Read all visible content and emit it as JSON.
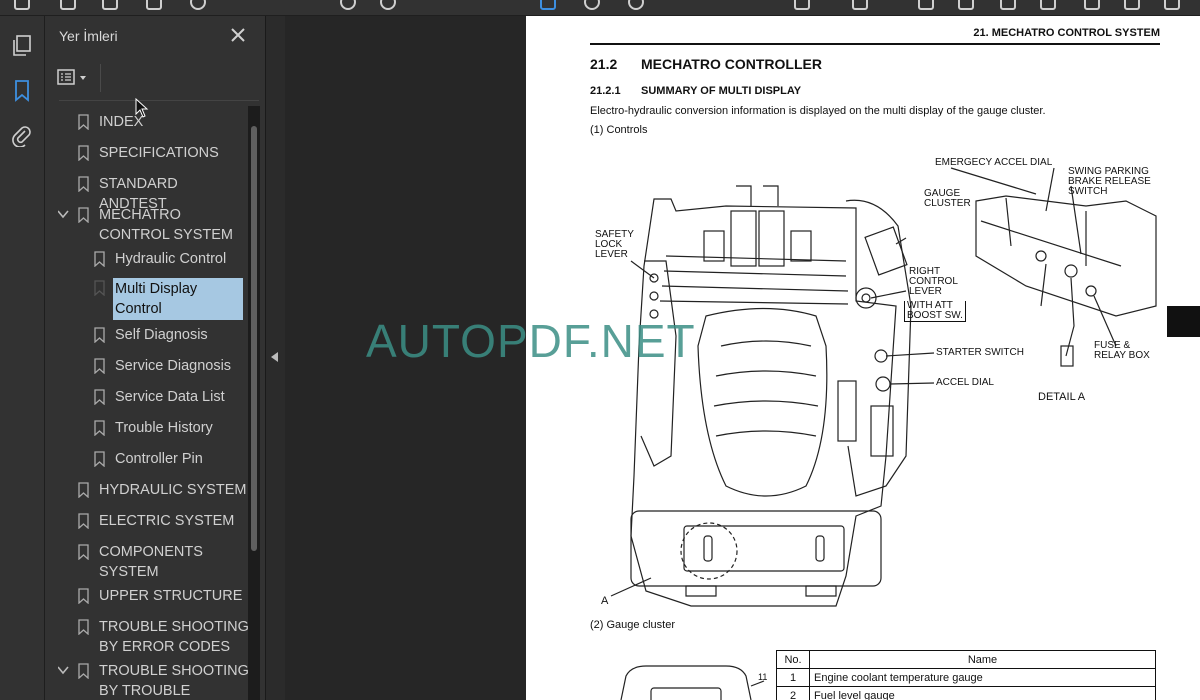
{
  "sidebar_panel": {
    "title": "Yer İmleri",
    "items": [
      {
        "label": "INDEX",
        "level": 0,
        "expanded": false
      },
      {
        "label": "SPECIFICATIONS",
        "level": 0,
        "expanded": false
      },
      {
        "label": "STANDARD ANDTEST",
        "level": 0,
        "expanded": false
      },
      {
        "label": "MECHATRO CONTROL SYSTEM",
        "level": 0,
        "expanded": true
      },
      {
        "label": "Hydraulic Control",
        "level": 1,
        "expanded": false
      },
      {
        "label": "Multi Display Control",
        "level": 1,
        "expanded": false,
        "selected": true
      },
      {
        "label": "Self Diagnosis",
        "level": 1,
        "expanded": false
      },
      {
        "label": "Service Diagnosis",
        "level": 1,
        "expanded": false
      },
      {
        "label": "Service Data List",
        "level": 1,
        "expanded": false
      },
      {
        "label": "Trouble History",
        "level": 1,
        "expanded": false
      },
      {
        "label": "Controller Pin",
        "level": 1,
        "expanded": false
      },
      {
        "label": "HYDRAULIC SYSTEM",
        "level": 0,
        "expanded": false
      },
      {
        "label": "ELECTRIC SYSTEM",
        "level": 0,
        "expanded": false
      },
      {
        "label": "COMPONENTS SYSTEM",
        "level": 0,
        "expanded": false
      },
      {
        "label": "UPPER STRUCTURE",
        "level": 0,
        "expanded": false
      },
      {
        "label": "TROUBLE SHOOTING BY ERROR CODES",
        "level": 0,
        "expanded": false
      },
      {
        "label": "TROUBLE SHOOTING BY TROUBLE",
        "level": 0,
        "expanded": true
      }
    ]
  },
  "document": {
    "header": "21. MECHATRO CONTROL SYSTEM",
    "section_number": "21.2",
    "section_title": "MECHATRO CONTROLLER",
    "subsection_number": "21.2.1",
    "subsection_title": "SUMMARY OF MULTI DISPLAY",
    "intro": "Electro-hydraulic conversion information is displayed on the multi display of the gauge cluster.",
    "controls_label": "(1)  Controls",
    "gauge_label": "(2)  Gauge cluster",
    "callouts": {
      "emergency_accel": "EMERGECY ACCEL DIAL",
      "swing_parking": "SWING PARKING\nBRAKE RELEASE\nSWITCH",
      "gauge_cluster": "GAUGE\nCLUSTER",
      "safety_lock": "SAFETY\nLOCK\nLEVER",
      "right_control": "RIGHT\nCONTROL\nLEVER",
      "att_boost": "WITH ATT\nBOOST SW.",
      "starter": "STARTER SWITCH",
      "accel_dial": "ACCEL DIAL",
      "fuse_relay": "FUSE &\nRELAY BOX",
      "detail_a": "DETAIL A",
      "ref_a": "A",
      "ref_11": "11"
    },
    "table": {
      "headers": [
        "No.",
        "Name"
      ],
      "rows": [
        [
          "1",
          "Engine coolant temperature gauge"
        ],
        [
          "2",
          "Fuel level gauge"
        ]
      ]
    }
  },
  "watermark": "AUTOPDF.NET",
  "colors": {
    "watermark": "#3c8f86",
    "selection": "#a6c8e2",
    "accent": "#3d8fe0"
  }
}
